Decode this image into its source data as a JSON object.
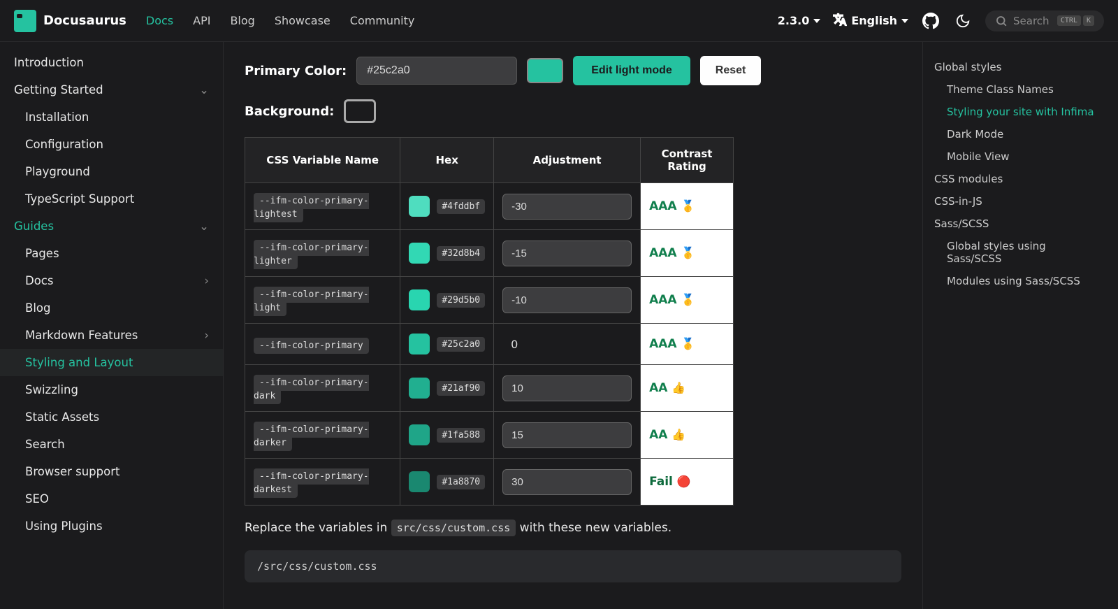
{
  "brand": "Docusaurus",
  "nav": {
    "links": [
      "Docs",
      "API",
      "Blog",
      "Showcase",
      "Community"
    ],
    "active": 0,
    "version": "2.3.0",
    "language": "English",
    "search_placeholder": "Search",
    "kbd1": "CTRL",
    "kbd2": "K"
  },
  "sidebar": [
    {
      "label": "Introduction",
      "type": "item"
    },
    {
      "label": "Getting Started",
      "type": "cat",
      "expanded": true
    },
    {
      "label": "Installation",
      "type": "sub"
    },
    {
      "label": "Configuration",
      "type": "sub"
    },
    {
      "label": "Playground",
      "type": "sub"
    },
    {
      "label": "TypeScript Support",
      "type": "sub"
    },
    {
      "label": "Guides",
      "type": "cat",
      "expanded": true,
      "active_cat": true
    },
    {
      "label": "Pages",
      "type": "sub"
    },
    {
      "label": "Docs",
      "type": "sub",
      "has_chevron": true
    },
    {
      "label": "Blog",
      "type": "sub"
    },
    {
      "label": "Markdown Features",
      "type": "sub",
      "has_chevron": true
    },
    {
      "label": "Styling and Layout",
      "type": "sub",
      "active": true
    },
    {
      "label": "Swizzling",
      "type": "sub"
    },
    {
      "label": "Static Assets",
      "type": "sub"
    },
    {
      "label": "Search",
      "type": "sub"
    },
    {
      "label": "Browser support",
      "type": "sub"
    },
    {
      "label": "SEO",
      "type": "sub"
    },
    {
      "label": "Using Plugins",
      "type": "sub"
    }
  ],
  "content": {
    "primary_color_label": "Primary Color:",
    "primary_color_value": "#25c2a0",
    "primary_swatch_color": "#25c2a0",
    "edit_button": "Edit light mode",
    "reset_button": "Reset",
    "background_label": "Background:",
    "background_swatch_color": "#1b1b1d",
    "table_headers": [
      "CSS Variable Name",
      "Hex",
      "Adjustment",
      "Contrast Rating"
    ],
    "rows": [
      {
        "var": "--ifm-color-primary-lightest",
        "hex": "#4fddbf",
        "swatch": "#4fddbf",
        "adj": "-30",
        "adj_input": true,
        "rating": "AAA",
        "emoji": "🥇"
      },
      {
        "var": "--ifm-color-primary-lighter",
        "hex": "#32d8b4",
        "swatch": "#32d8b4",
        "adj": "-15",
        "adj_input": true,
        "rating": "AAA",
        "emoji": "🥇"
      },
      {
        "var": "--ifm-color-primary-light",
        "hex": "#29d5b0",
        "swatch": "#29d5b0",
        "adj": "-10",
        "adj_input": true,
        "rating": "AAA",
        "emoji": "🥇"
      },
      {
        "var": "--ifm-color-primary",
        "hex": "#25c2a0",
        "swatch": "#25c2a0",
        "adj": "0",
        "adj_input": false,
        "rating": "AAA",
        "emoji": "🥇"
      },
      {
        "var": "--ifm-color-primary-dark",
        "hex": "#21af90",
        "swatch": "#21af90",
        "adj": "10",
        "adj_input": true,
        "rating": "AA",
        "emoji": "👍"
      },
      {
        "var": "--ifm-color-primary-darker",
        "hex": "#1fa588",
        "swatch": "#1fa588",
        "adj": "15",
        "adj_input": true,
        "rating": "AA",
        "emoji": "👍"
      },
      {
        "var": "--ifm-color-primary-darkest",
        "hex": "#1a8870",
        "swatch": "#1a8870",
        "adj": "30",
        "adj_input": true,
        "rating": "Fail",
        "emoji": "🔴"
      }
    ],
    "paragraph_pre": "Replace the variables in ",
    "paragraph_code": "src/css/custom.css",
    "paragraph_post": " with these new variables.",
    "codeblock_title": "/src/css/custom.css"
  },
  "toc": [
    {
      "label": "Global styles",
      "sub": false
    },
    {
      "label": "Theme Class Names",
      "sub": true
    },
    {
      "label": "Styling your site with Infima",
      "sub": true,
      "active": true
    },
    {
      "label": "Dark Mode",
      "sub": true
    },
    {
      "label": "Mobile View",
      "sub": true
    },
    {
      "label": "CSS modules",
      "sub": false
    },
    {
      "label": "CSS-in-JS",
      "sub": false
    },
    {
      "label": "Sass/SCSS",
      "sub": false
    },
    {
      "label": "Global styles using Sass/SCSS",
      "sub": true
    },
    {
      "label": "Modules using Sass/SCSS",
      "sub": true
    }
  ]
}
